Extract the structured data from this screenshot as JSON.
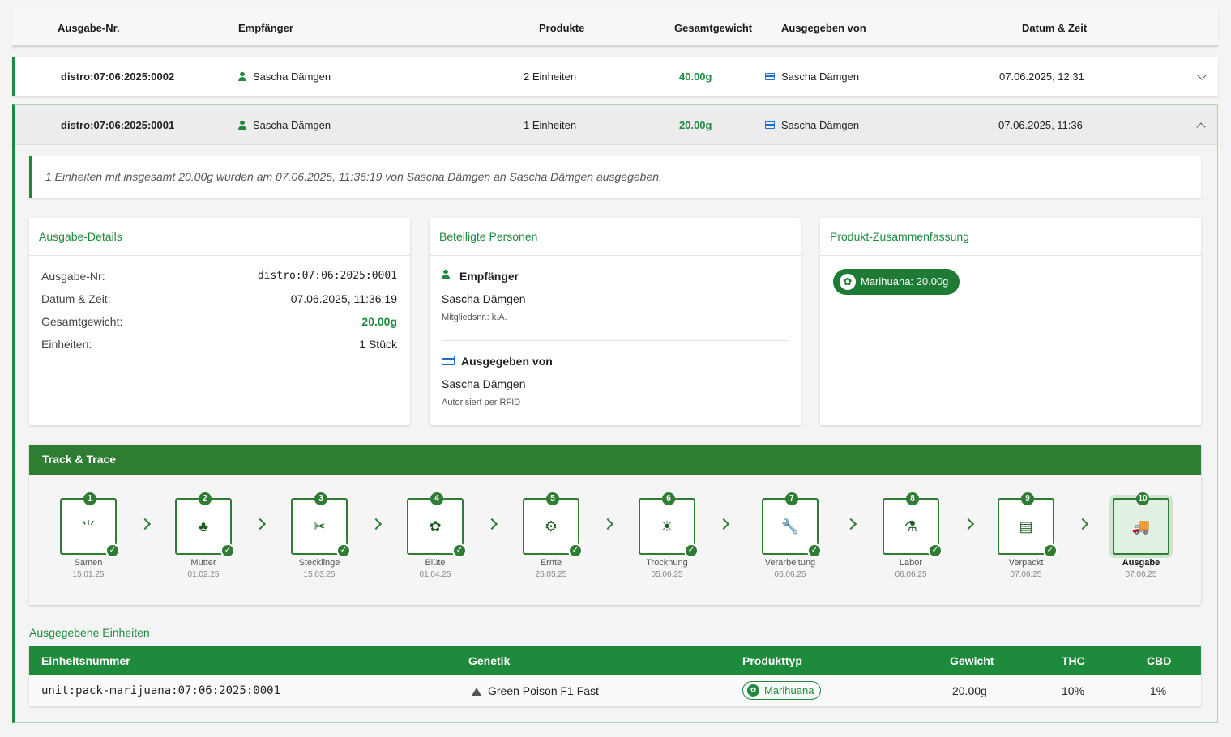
{
  "table": {
    "headers": [
      "Ausgabe-Nr.",
      "Empfänger",
      "Produkte",
      "Gesamtgewicht",
      "Ausgegeben von",
      "Datum & Zeit"
    ],
    "rows": [
      {
        "id": "distro:07:06:2025:0002",
        "recipient": "Sascha Dämgen",
        "products": "2 Einheiten",
        "weight": "40.00g",
        "issuer": "Sascha Dämgen",
        "datetime": "07.06.2025, 12:31"
      },
      {
        "id": "distro:07:06:2025:0001",
        "recipient": "Sascha Dämgen",
        "products": "1 Einheiten",
        "weight": "20.00g",
        "issuer": "Sascha Dämgen",
        "datetime": "07.06.2025, 11:36"
      }
    ]
  },
  "detail": {
    "summary": "1 Einheiten mit insgesamt 20.00g wurden am 07.06.2025, 11:36:19 von Sascha Dämgen an Sascha Dämgen ausgegeben.",
    "details_card": {
      "title": "Ausgabe-Details",
      "items": [
        {
          "key": "Ausgabe-Nr:",
          "value": "distro:07:06:2025:0001"
        },
        {
          "key": "Datum & Zeit:",
          "value": "07.06.2025, 11:36:19"
        },
        {
          "key": "Gesamtgewicht:",
          "value": "20.00g"
        },
        {
          "key": "Einheiten:",
          "value": "1 Stück"
        }
      ]
    },
    "persons_card": {
      "title": "Beteiligte Personen",
      "recipient_title": "Empfänger",
      "recipient_name": "Sascha Dämgen",
      "recipient_sub": "Mitgliedsnr.: k.A.",
      "issuer_title": "Ausgegeben von",
      "issuer_name": "Sascha Dämgen",
      "issuer_sub": "Autorisiert per RFID"
    },
    "product_card": {
      "title": "Produkt-Zusammenfassung",
      "chip": "Marihuana: 20.00g"
    }
  },
  "track": {
    "title": "Track & Trace",
    "steps": [
      {
        "num": "1",
        "label": "Samen",
        "date": "15.01.25",
        "icon": "seedling-icon",
        "glyph": "⺌"
      },
      {
        "num": "2",
        "label": "Mutter",
        "date": "01.02.25",
        "icon": "tree-icon",
        "glyph": "♣"
      },
      {
        "num": "3",
        "label": "Stecklinge",
        "date": "15.03.25",
        "icon": "scissors-icon",
        "glyph": "✂"
      },
      {
        "num": "4",
        "label": "Blüte",
        "date": "01.04.25",
        "icon": "flower-icon",
        "glyph": "✿"
      },
      {
        "num": "5",
        "label": "Ernte",
        "date": "26.05.25",
        "icon": "tractor-icon",
        "glyph": "⚙"
      },
      {
        "num": "6",
        "label": "Trocknung",
        "date": "05.06.25",
        "icon": "sun-icon",
        "glyph": "☀"
      },
      {
        "num": "7",
        "label": "Verarbeitung",
        "date": "06.06.25",
        "icon": "wrench-icon",
        "glyph": "🔧"
      },
      {
        "num": "8",
        "label": "Labor",
        "date": "06.06.25",
        "icon": "flask-icon",
        "glyph": "⚗"
      },
      {
        "num": "9",
        "label": "Verpackt",
        "date": "07.06.25",
        "icon": "archive-icon",
        "glyph": "▤"
      },
      {
        "num": "10",
        "label": "Ausgabe",
        "date": "07.06.25",
        "icon": "truck-icon",
        "glyph": "🚚"
      }
    ],
    "check": "✓"
  },
  "units": {
    "title": "Ausgegebene Einheiten",
    "headers": [
      "Einheitsnummer",
      "Genetik",
      "Produkttyp",
      "Gewicht",
      "THC",
      "CBD"
    ],
    "rows": [
      {
        "unit": "unit:pack-marijuana:07:06:2025:0001",
        "genetics": "Green Poison F1 Fast",
        "type": "Marihuana",
        "weight": "20.00g",
        "thc": "10%",
        "cbd": "1%"
      }
    ]
  },
  "colors": {
    "accent": "#1e8a3c",
    "trackHeader": "#2e7d32",
    "cardIcon": "#1a73c8"
  }
}
